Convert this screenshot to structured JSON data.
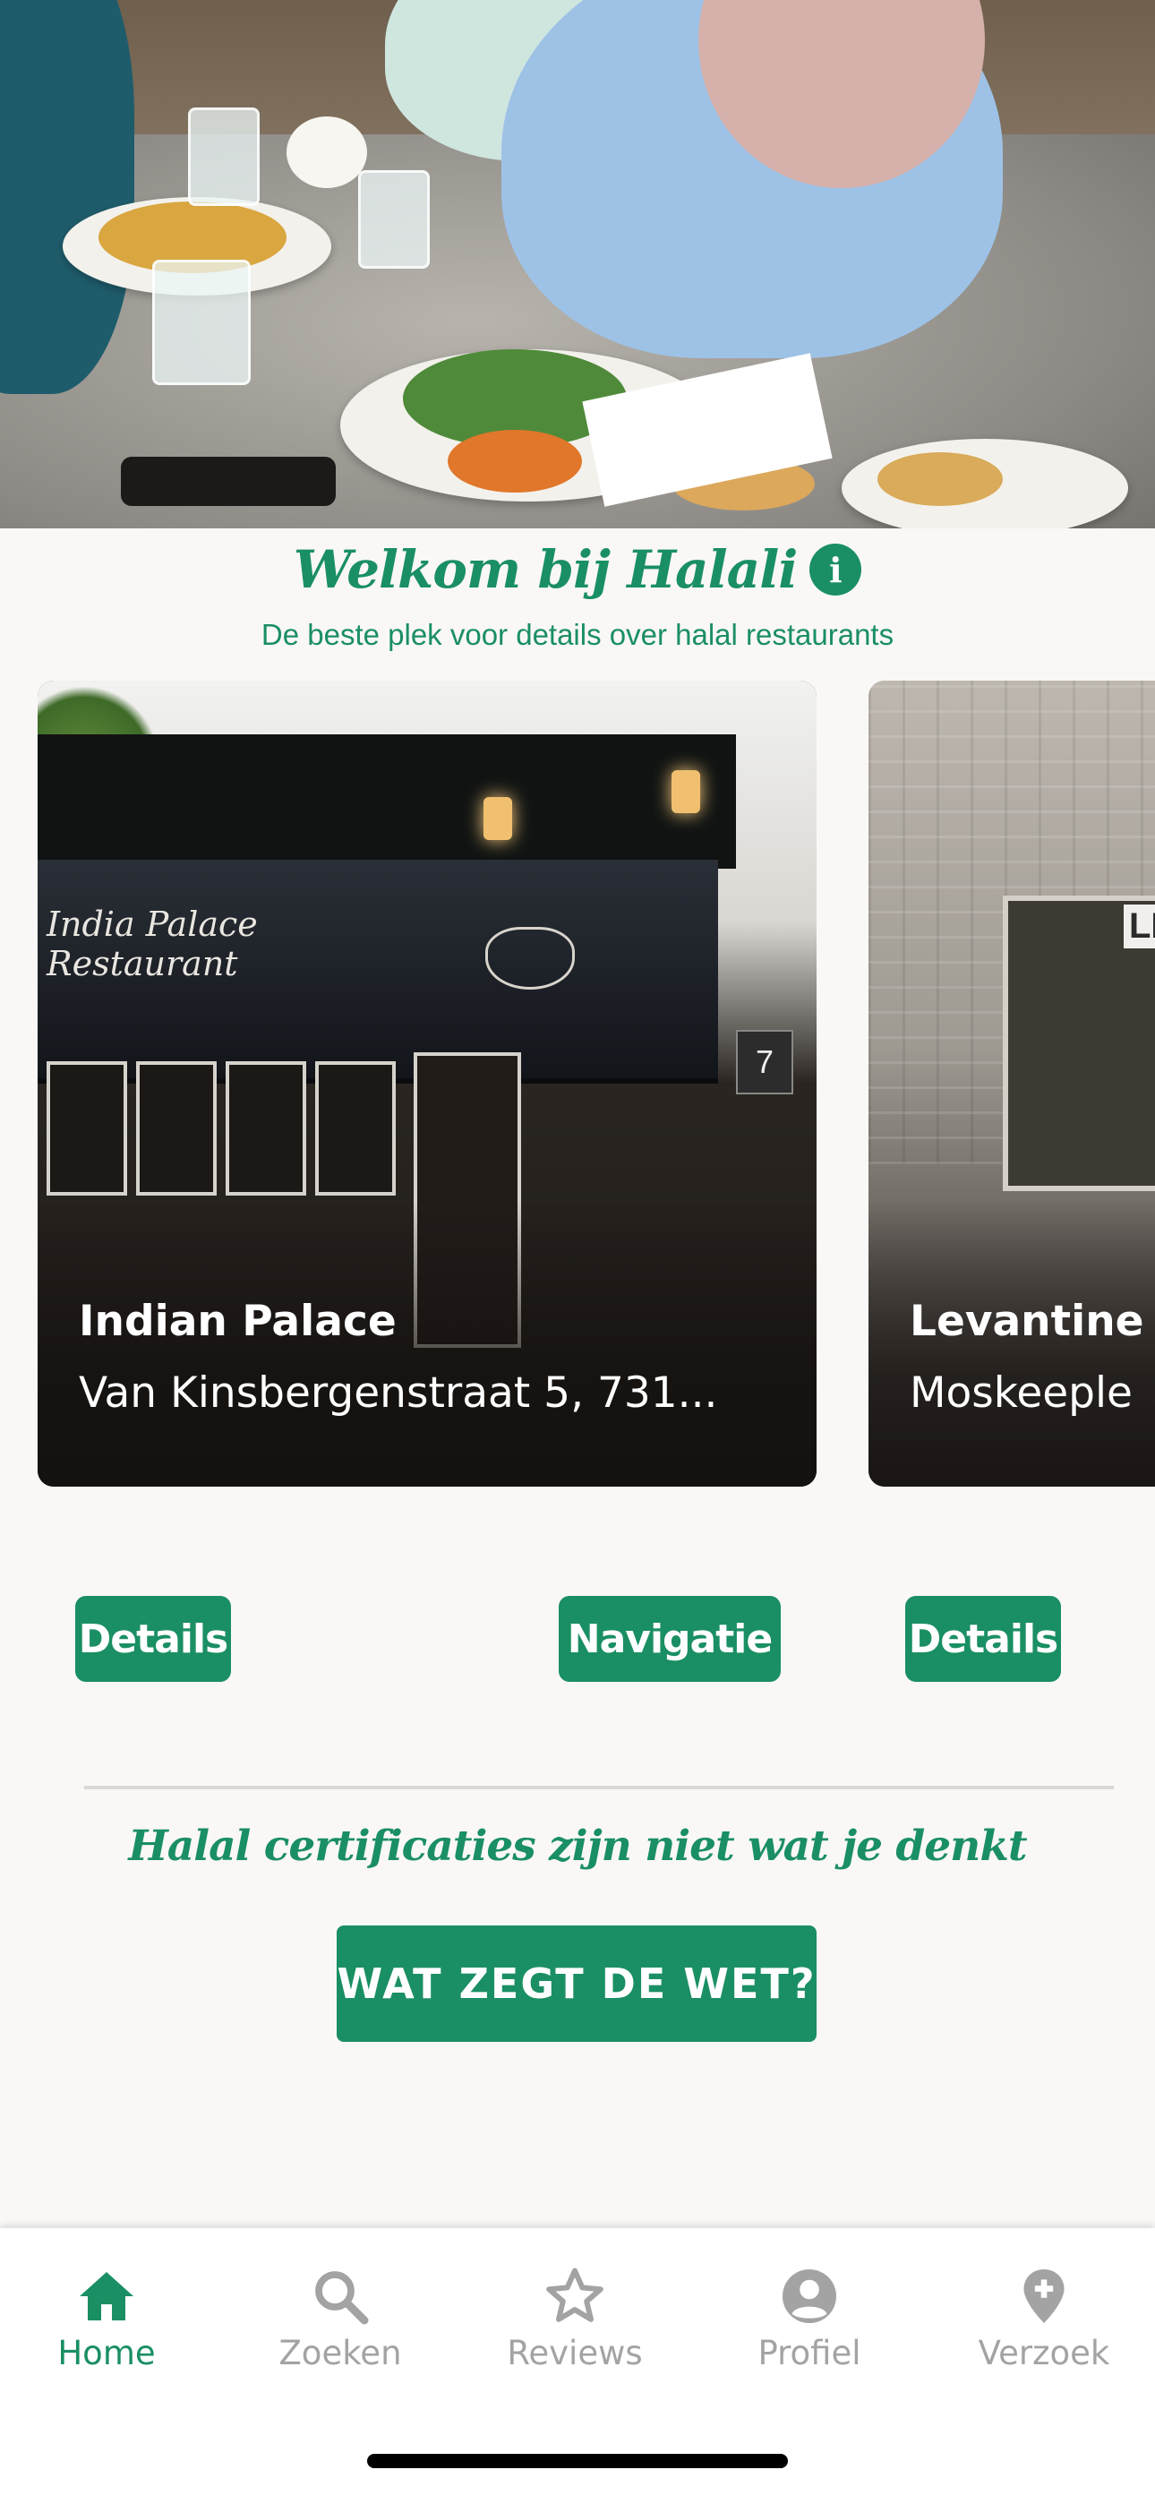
{
  "welcome": {
    "title": "Welkom bij Halali",
    "subtitle": "De beste plek voor details over halal restaurants"
  },
  "restaurants": [
    {
      "name": "Indian Palace",
      "address": "Van Kinsbergenstraat 5, 731...",
      "sign_text": "India Palace Restaurant",
      "house_number": "7",
      "details_label": "Details",
      "navigation_label": "Navigatie"
    },
    {
      "name": "Levantine",
      "address": "Moskeeple",
      "sign_text": "LE",
      "details_label": "Details"
    }
  ],
  "certification": {
    "text": "Halal certificaties zijn niet wat je denkt",
    "button_label": "WAT ZEGT DE WET?"
  },
  "bottom_nav": {
    "items": [
      {
        "label": "Home",
        "icon": "home-icon",
        "active": true
      },
      {
        "label": "Zoeken",
        "icon": "search-icon",
        "active": false
      },
      {
        "label": "Reviews",
        "icon": "star-icon",
        "active": false
      },
      {
        "label": "Profiel",
        "icon": "profile-icon",
        "active": false
      },
      {
        "label": "Verzoek",
        "icon": "location-add-icon",
        "active": false
      }
    ]
  },
  "colors": {
    "brand_green": "#1a8f63",
    "inactive_gray": "#a3a3a3",
    "background": "#faf8f6"
  }
}
